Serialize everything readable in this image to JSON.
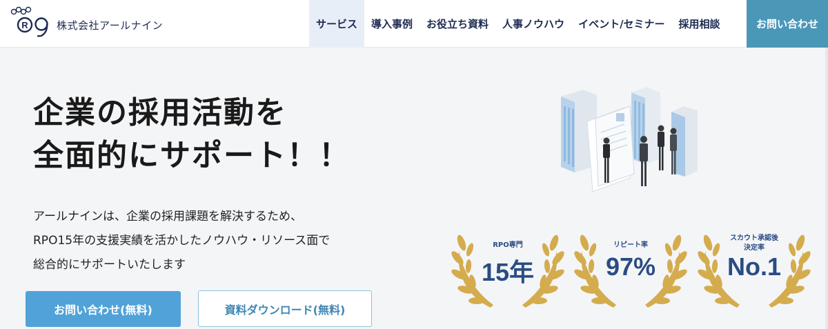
{
  "header": {
    "company_name": "株式会社アールナイン",
    "nav": [
      {
        "label": "サービス"
      },
      {
        "label": "導入事例"
      },
      {
        "label": "お役立ち資料"
      },
      {
        "label": "人事ノウハウ"
      },
      {
        "label": "イベント/セミナー"
      },
      {
        "label": "採用相談"
      }
    ],
    "contact_label": "お問い合わせ"
  },
  "hero": {
    "title_line1": "企業の採用活動を",
    "title_line2": "全面的にサポート！！",
    "desc_line1": "アールナインは、企業の採用課題を解決するため、",
    "desc_line2": "RPO15年の支援実績を活かしたノウハウ・リソース面で",
    "desc_line3": "総合的にサポートいたします",
    "cta_primary": "お問い合わせ(無料)",
    "cta_secondary": "資料ダウンロード(無料)"
  },
  "awards": [
    {
      "label": "RPO専門",
      "value": "15年"
    },
    {
      "label": "リピート率",
      "value": "97%"
    },
    {
      "label_line1": "スカウト承認後",
      "label_line2": "決定率",
      "value": "No.1"
    }
  ],
  "colors": {
    "accent": "#4a97b8",
    "primary_button": "#51a2d8",
    "navy": "#1d2b50",
    "gold": "#d4ac4e"
  }
}
